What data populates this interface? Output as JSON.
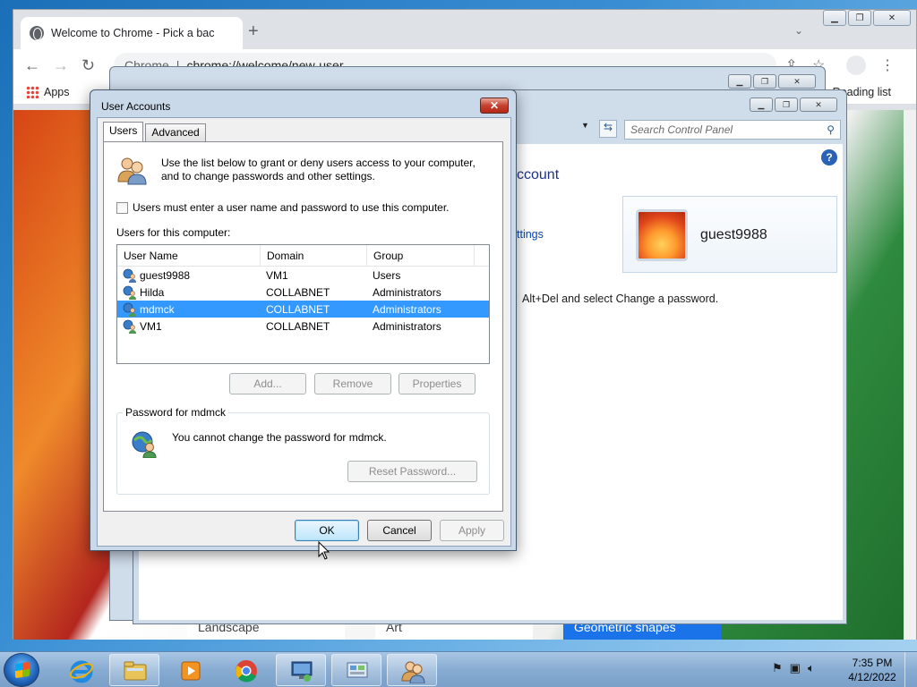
{
  "chrome": {
    "tab_title": "Welcome to Chrome - Pick a bac",
    "new_tab": "+",
    "tab_search": "⌄",
    "omnibox_prefix": "Chrome",
    "omnibox_sep": "|",
    "omnibox_url": "chrome://welcome/new-user",
    "apps_label": "Apps",
    "reading_list_label": "Reading list",
    "cards": [
      "Landscape",
      "Art",
      "Geometric shapes"
    ]
  },
  "control_panel": {
    "search_placeholder": "Search Control Panel",
    "heading": "ccount",
    "link_partial": "ttings",
    "user_name": "guest9988",
    "note": "Alt+Del and select Change a password."
  },
  "dialog": {
    "title": "User Accounts",
    "close": "✕",
    "tabs": [
      "Users",
      "Advanced"
    ],
    "intro": "Use the list below to grant or deny users access to your computer, and to change passwords and other settings.",
    "checkbox_label": "Users must enter a user name and password to use this computer.",
    "users_label": "Users for this computer:",
    "columns": [
      "User Name",
      "Domain",
      "Group"
    ],
    "rows": [
      {
        "name": "guest9988",
        "domain": "VM1",
        "group": "Users"
      },
      {
        "name": "Hilda",
        "domain": "COLLABNET",
        "group": "Administrators"
      },
      {
        "name": "mdmck",
        "domain": "COLLABNET",
        "group": "Administrators"
      },
      {
        "name": "VM1",
        "domain": "COLLABNET",
        "group": "Administrators"
      }
    ],
    "selected_row": 2,
    "buttons": {
      "add": "Add...",
      "remove": "Remove",
      "properties": "Properties"
    },
    "password_group": "Password for mdmck",
    "password_text": "You cannot change the password for mdmck.",
    "reset_password": "Reset Password...",
    "ok": "OK",
    "cancel": "Cancel",
    "apply": "Apply"
  },
  "taskbar": {
    "time": "7:35 PM",
    "date": "4/12/2022"
  }
}
